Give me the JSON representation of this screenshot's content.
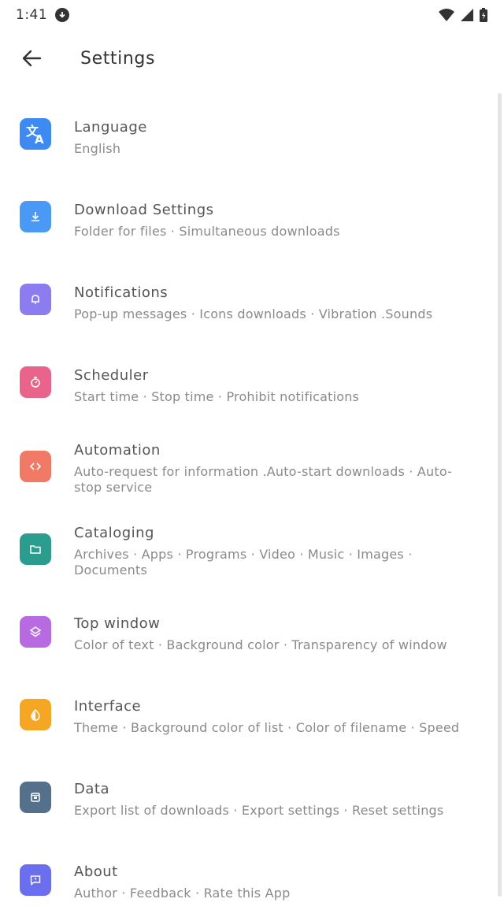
{
  "status_bar": {
    "time": "1:41"
  },
  "app_bar": {
    "title": "Settings"
  },
  "colors": {
    "language": "#3d8bf2",
    "download": "#4a9af5",
    "notifications": "#8b7cf0",
    "scheduler": "#e8648a",
    "automation": "#f07a66",
    "cataloging": "#2a9d8f",
    "top_window": "#b86be0",
    "interface": "#f5a623",
    "data": "#55708a",
    "about": "#6c6ef0"
  },
  "items": [
    {
      "title": "Language",
      "subtitle": "English",
      "icon": "translate-icon"
    },
    {
      "title": "Download Settings",
      "subtitle": "Folder for files · Simultaneous downloads",
      "icon": "download-icon"
    },
    {
      "title": "Notifications",
      "subtitle": "Pop-up messages · Icons downloads · Vibration .Sounds",
      "icon": "bell-icon"
    },
    {
      "title": "Scheduler",
      "subtitle": "Start time · Stop time · Prohibit notifications",
      "icon": "timer-icon"
    },
    {
      "title": "Automation",
      "subtitle": "Auto-request for information .Auto-start downloads · Auto-stop service",
      "icon": "code-icon"
    },
    {
      "title": "Cataloging",
      "subtitle": "Archives · Apps · Programs · Video · Music · Images · Documents",
      "icon": "folder-icon"
    },
    {
      "title": "Top window",
      "subtitle": "Color of text · Background color · Transparency of window",
      "icon": "layers-icon"
    },
    {
      "title": "Interface",
      "subtitle": "Theme · Background color of list · Color of filename · Speed",
      "icon": "contrast-icon"
    },
    {
      "title": "Data",
      "subtitle": "Export list of downloads · Export settings · Reset settings",
      "icon": "database-icon"
    },
    {
      "title": "About",
      "subtitle": "Author · Feedback · Rate this App",
      "icon": "info-message-icon"
    }
  ]
}
